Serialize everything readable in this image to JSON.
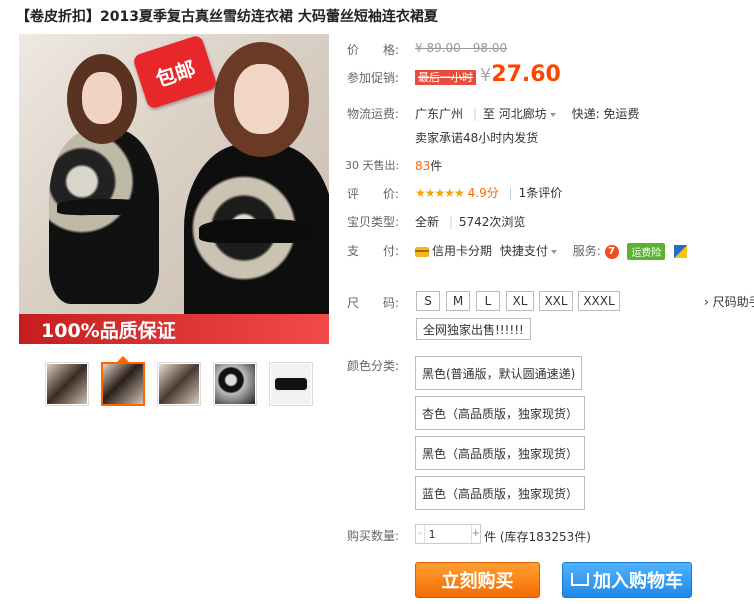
{
  "product": {
    "tag": "【卷皮折扣】",
    "title": "2013夏季复古真丝雪纺连衣裙 大码蕾丝短袖连衣裙夏",
    "badge_text": "包邮",
    "quality_banner": "100%品质保证"
  },
  "price": {
    "label": "价　　格:",
    "original": "¥ 89.00 - 98.00",
    "promo_label": "参加促销:",
    "promo_tag": "最后一小时",
    "currency": "¥",
    "current": "27.60"
  },
  "shipping": {
    "label": "物流运费:",
    "from": "广东广州",
    "to_prefix": "至",
    "to": "河北廊坊",
    "fee": "快递: 免运费",
    "note": "卖家承诺48小时内发货"
  },
  "sales": {
    "label": "30 天售出:",
    "count": "83",
    "unit": "件"
  },
  "rating": {
    "label": "评　　价:",
    "stars": "★★★★★",
    "score": "4.9分",
    "reviews": "1条评价"
  },
  "type": {
    "label": "宝贝类型:",
    "condition": "全新",
    "views": "5742次浏览"
  },
  "payment": {
    "label": "支　　付:",
    "credit": "信用卡分期",
    "quick": "快捷支付",
    "service_label": "服务:",
    "service_badge": "运费险",
    "seven_icon": "7"
  },
  "size": {
    "label": "尺　　码:",
    "options": [
      "S",
      "M",
      "L",
      "XL",
      "XXL",
      "XXXL"
    ],
    "help": "› 尺码助手",
    "exclusive": "全网独家出售!!!!!!"
  },
  "colors": {
    "label": "颜色分类:",
    "options": [
      "黑色(普通版，默认圆通速递)",
      "杏色（高品质版，独家现货）",
      "黑色（高品质版，独家现货）",
      "蓝色（高品质版，独家现货）"
    ]
  },
  "quantity": {
    "label": "购买数量:",
    "value": "1",
    "minus": "-",
    "plus": "+",
    "stock": "件 (库存183253件)"
  },
  "buttons": {
    "buy": "立刻购买",
    "cart": "加入购物车"
  },
  "colors_theme": {
    "price": "#ff4400",
    "buy": "#f36b00",
    "cart": "#1e89e6"
  }
}
